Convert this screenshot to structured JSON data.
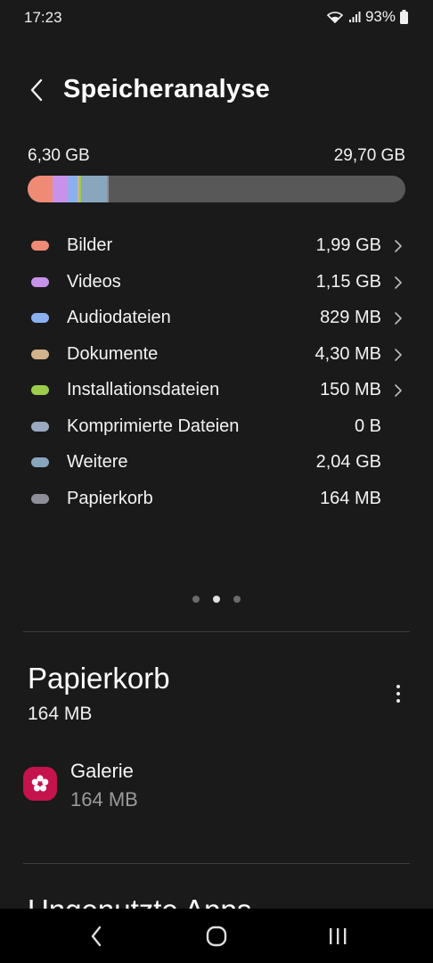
{
  "status_bar": {
    "time": "17:23",
    "battery": "93%",
    "icons": [
      "wifi-icon",
      "signal-icon",
      "battery-icon"
    ]
  },
  "header": {
    "title": "Speicheranalyse",
    "back_icon": "back-arrow-icon"
  },
  "storage": {
    "used": "6,30 GB",
    "total": "29,70 GB",
    "bar_track_color": "#585858"
  },
  "categories": [
    {
      "name": "Bilder",
      "size": "1,99 GB",
      "color": "#ef8a74",
      "has_chevron": true
    },
    {
      "name": "Videos",
      "size": "1,15 GB",
      "color": "#c792ea",
      "has_chevron": true
    },
    {
      "name": "Audiodateien",
      "size": "829 MB",
      "color": "#8ab0f0",
      "has_chevron": true
    },
    {
      "name": "Dokumente",
      "size": "4,30 MB",
      "color": "#d2b48c",
      "has_chevron": true
    },
    {
      "name": "Installationsdateien",
      "size": "150 MB",
      "color": "#9ccc4a",
      "has_chevron": true
    },
    {
      "name": "Komprimierte Dateien",
      "size": "0 B",
      "color": "#9aa8c0",
      "has_chevron": false
    },
    {
      "name": "Weitere",
      "size": "2,04 GB",
      "color": "#8aa6bc",
      "has_chevron": false
    },
    {
      "name": "Papierkorb",
      "size": "164 MB",
      "color": "#8e8e98",
      "has_chevron": false
    }
  ],
  "pager": {
    "count": 3,
    "active_index": 1
  },
  "trash_section": {
    "title": "Papierkorb",
    "size": "164 MB",
    "more_icon": "more-vertical-icon",
    "app": {
      "name": "Galerie",
      "size": "164 MB",
      "icon": "gallery-flower-icon",
      "icon_color": "#c4134d"
    }
  },
  "next_section": {
    "title": "Ungenutzte Apps"
  },
  "nav_bar": {
    "icons": [
      "back-nav-icon",
      "home-nav-icon",
      "recents-nav-icon"
    ]
  }
}
